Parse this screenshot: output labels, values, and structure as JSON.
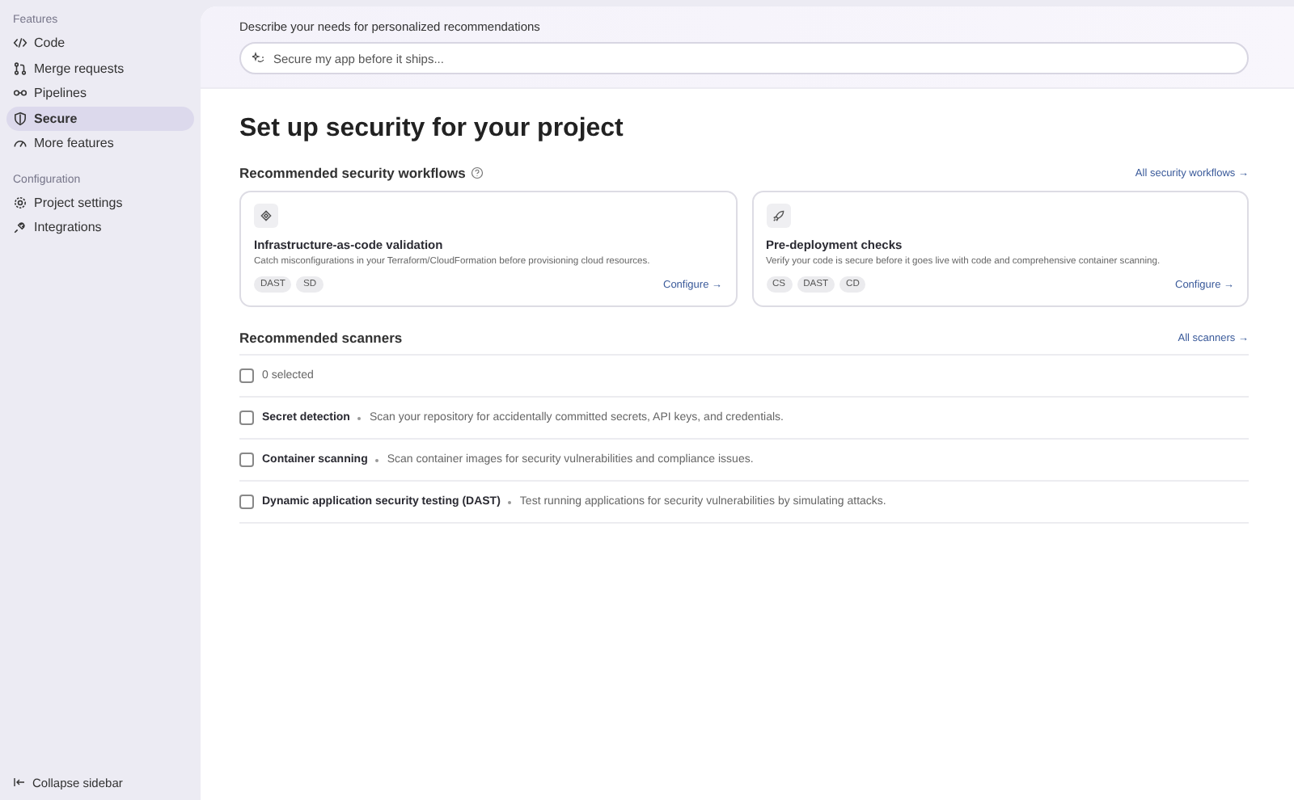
{
  "sidebar": {
    "sections": [
      {
        "label": "Features",
        "items": [
          {
            "label": "Code",
            "selected": false
          },
          {
            "label": "Merge requests",
            "selected": false
          },
          {
            "label": "Pipelines",
            "selected": false
          },
          {
            "label": "Secure",
            "selected": true
          },
          {
            "label": "More features",
            "selected": false
          }
        ]
      },
      {
        "label": "Configuration",
        "items": [
          {
            "label": "Project settings",
            "selected": false
          },
          {
            "label": "Integrations",
            "selected": false
          }
        ]
      }
    ],
    "collapse": "Collapse sidebar"
  },
  "prompt": {
    "label": "Describe your needs for personalized recommendations",
    "placeholder": "Secure my app before it ships..."
  },
  "title": "Set up security for your project",
  "workflows": {
    "heading": "Recommended security workflows",
    "link": "All security workflows →",
    "cards": [
      {
        "title": "Infrastructure-as-code validation",
        "description": "Catch misconfigurations in your Terraform/CloudFormation before provisioning cloud resources.",
        "tags": [
          "DAST",
          "SD"
        ],
        "action": "Configure →"
      },
      {
        "title": "Pre-deployment checks",
        "description": "Verify your code is secure before it goes live with code and comprehensive container scanning.",
        "tags": [
          "CS",
          "DAST",
          "CD"
        ],
        "action": "Configure →"
      }
    ]
  },
  "scanners": {
    "heading": "Recommended scanners",
    "link": "All scanners →",
    "select_all": {
      "label": "0 selected",
      "checked": false
    },
    "rows": [
      {
        "name": "Secret detection",
        "description": "Scan your repository for accidentally committed secrets, API keys, and credentials.",
        "checked": false
      },
      {
        "name": "Container scanning",
        "description": "Scan container images for security vulnerabilities and compliance issues.",
        "checked": false
      },
      {
        "name": "Dynamic application security testing (DAST)",
        "description": "Test running applications for security vulnerabilities by simulating attacks.",
        "checked": false
      }
    ]
  }
}
